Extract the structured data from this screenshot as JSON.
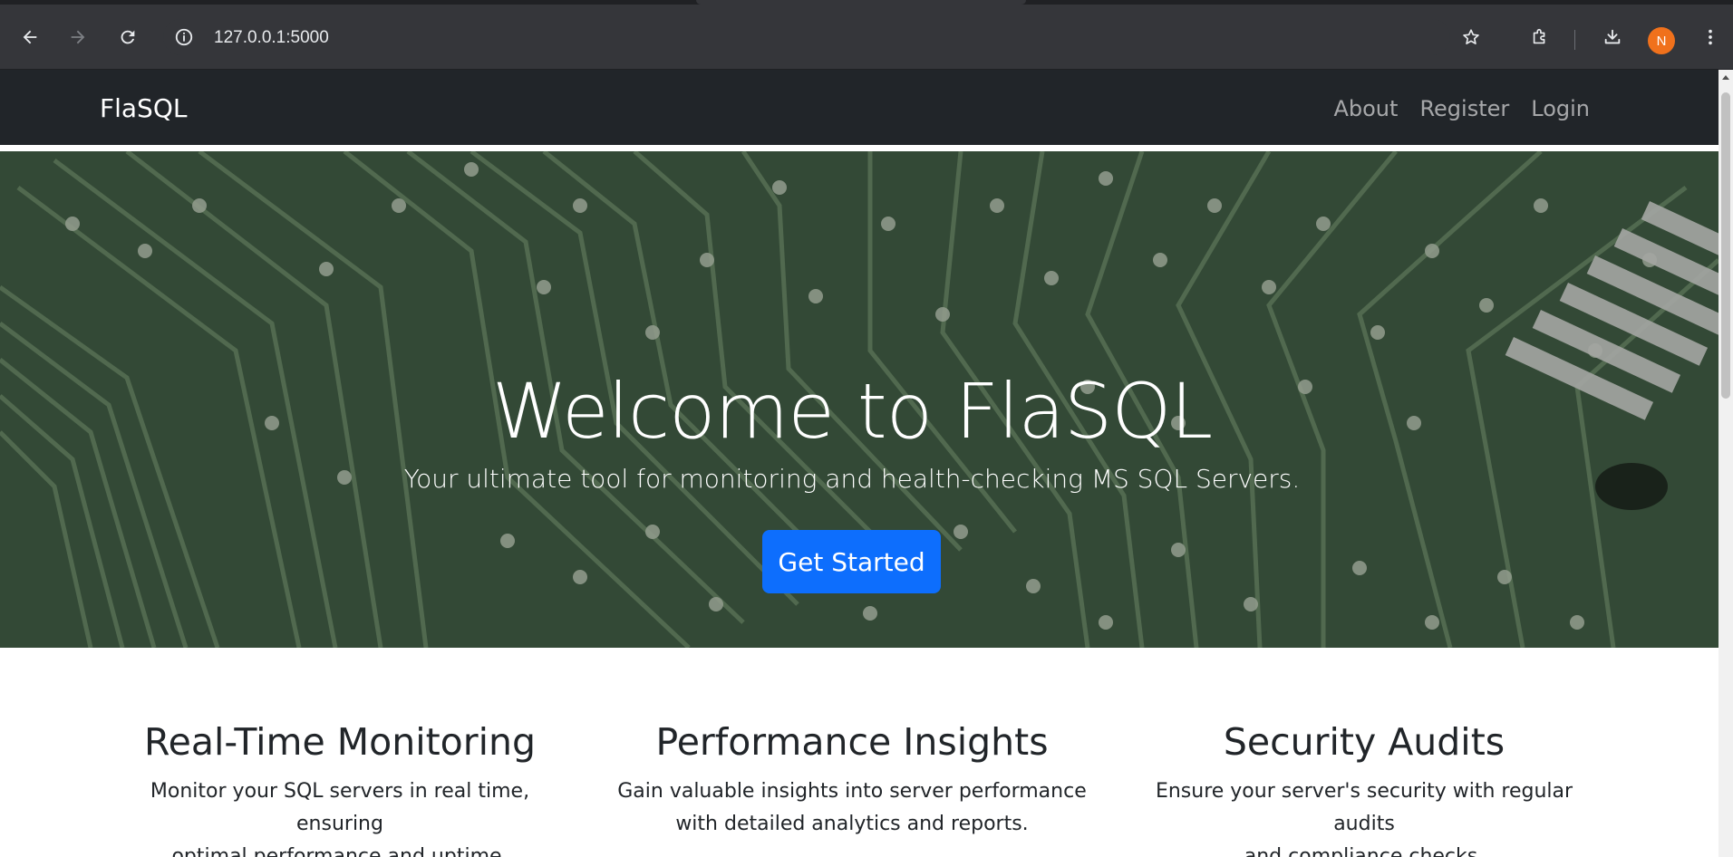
{
  "browser": {
    "url_host": "127.0.0.1",
    "url_port": ":5000",
    "profile_initial": "N",
    "icons": [
      "back-icon",
      "forward-icon",
      "reload-icon",
      "info-icon",
      "star-icon",
      "extensions-icon",
      "download-icon",
      "more-icon"
    ]
  },
  "navbar": {
    "brand": "FlaSQL",
    "links": [
      "About",
      "Register",
      "Login"
    ]
  },
  "hero": {
    "title": "Welcome to FlaSQL",
    "subtitle": "Your ultimate tool for monitoring and health-checking MS SQL Servers.",
    "button_label": "Get Started"
  },
  "features": [
    {
      "title": "Real-Time Monitoring",
      "text_line1": "Monitor your SQL servers in real time, ensuring",
      "text_line2": "optimal performance and uptime."
    },
    {
      "title": "Performance Insights",
      "text_line1": "Gain valuable insights into server performance",
      "text_line2": "with detailed analytics and reports."
    },
    {
      "title": "Security Audits",
      "text_line1": "Ensure your server's security with regular audits",
      "text_line2": "and compliance checks."
    }
  ],
  "colors": {
    "navbar_bg": "#212529",
    "primary_button": "#0d6efd",
    "pcb_green": "#3f5a42",
    "avatar_orange": "#f0711c"
  }
}
